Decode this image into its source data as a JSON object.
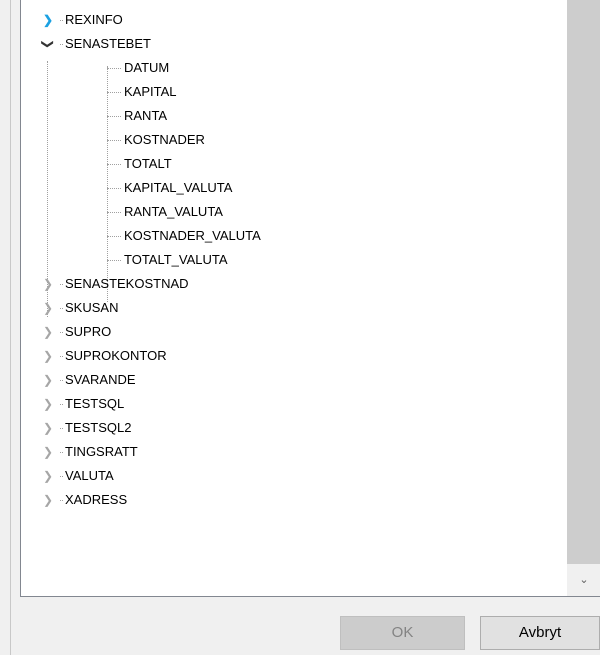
{
  "tree": {
    "expanded_node": {
      "label": "SENASTEBET",
      "children": [
        "DATUM",
        "KAPITAL",
        "RANTA",
        "KOSTNADER",
        "TOTALT",
        "KAPITAL_VALUTA",
        "RANTA_VALUTA",
        "KOSTNADER_VALUTA",
        "TOTALT_VALUTA"
      ]
    },
    "nodes_before": [
      "REXINFO"
    ],
    "nodes_after": [
      "SENASTEKOSTNAD",
      "SKUSAN",
      "SUPRO",
      "SUPROKONTOR",
      "SVARANDE",
      "TESTSQL",
      "TESTSQL2",
      "TINGSRATT",
      "VALUTA",
      "XADRESS"
    ],
    "icons": {
      "collapsed": "chevron-right-icon",
      "expanded": "chevron-down-icon",
      "scroll_down": "scroll-down-arrow-icon"
    }
  },
  "buttons": {
    "ok_label": "OK",
    "cancel_label": "Avbryt"
  },
  "colors": {
    "hover_chevron": "#1ba1e2",
    "disabled_button_bg": "#cccccc",
    "disabled_button_text": "#838383"
  }
}
